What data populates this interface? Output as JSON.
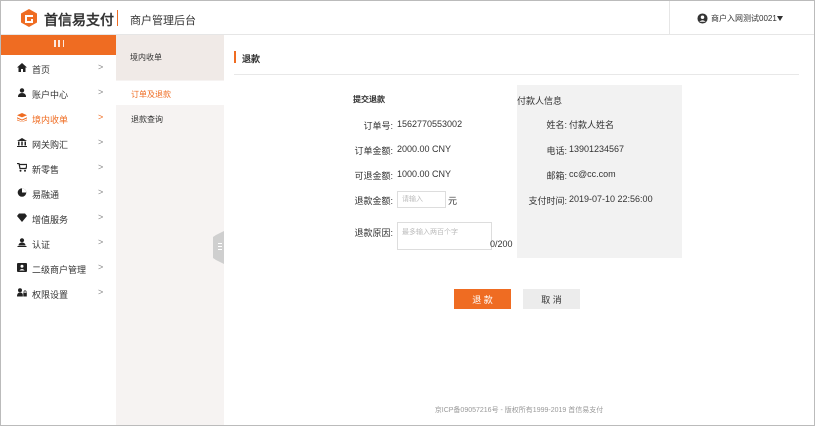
{
  "header": {
    "brand": "首信易支付",
    "portal": "商户管理后台",
    "user": "商户入网测试0021",
    "accent_color": "#ef6c22"
  },
  "nav": {
    "items": [
      {
        "label": "首页",
        "icon": "home-icon"
      },
      {
        "label": "账户中心",
        "icon": "user-icon"
      },
      {
        "label": "境内收单",
        "icon": "layers-icon",
        "active": true
      },
      {
        "label": "网关购汇",
        "icon": "bank-icon"
      },
      {
        "label": "新零售",
        "icon": "cart-icon"
      },
      {
        "label": "易融通",
        "icon": "pie-icon"
      },
      {
        "label": "增值服务",
        "icon": "diamond-icon"
      },
      {
        "label": "认证",
        "icon": "person-icon"
      },
      {
        "label": "二级商户管理",
        "icon": "merchant-icon"
      },
      {
        "label": "权限设置",
        "icon": "permission-icon"
      }
    ],
    "chevron": ">"
  },
  "subnav": {
    "title": "境内收单",
    "items": [
      {
        "label": "订单及退款",
        "active": true
      },
      {
        "label": "退款查询"
      }
    ]
  },
  "main": {
    "title": "退款",
    "form": {
      "title": "提交退款",
      "order_no_label": "订单号:",
      "order_no": "1562770553002",
      "order_amount_label": "订单金额:",
      "order_amount": "2000.00 CNY",
      "refundable_label": "可退金额:",
      "refundable": "1000.00 CNY",
      "refund_amount_label": "退款金额:",
      "refund_amount_placeholder": "请输入",
      "unit": "元",
      "reason_label": "退款原因:",
      "reason_placeholder": "最多输入两百个字",
      "reason_count": "0/200"
    },
    "payer": {
      "title": "付款人信息",
      "name_label": "姓名:",
      "name": "付款人姓名",
      "phone_label": "电话:",
      "phone": "13901234567",
      "email_label": "邮箱:",
      "email": "cc@cc.com",
      "time_label": "支付时间:",
      "time": "2019-07-10 22:56:00"
    },
    "buttons": {
      "refund": "退 款",
      "cancel": "取 消"
    }
  },
  "footer": "京ICP备09057216号 - 版权所有1999-2019 首信易支付"
}
